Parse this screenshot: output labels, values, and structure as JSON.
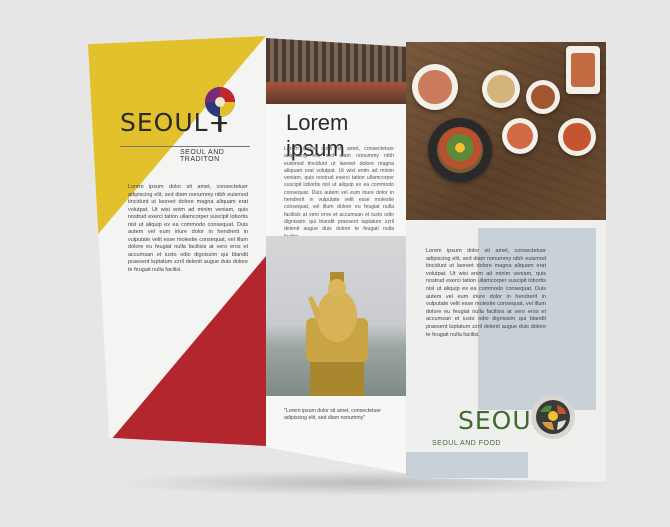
{
  "left_panel": {
    "brand": "SEOUL+",
    "tagline": "SEOUL AND TRADITON",
    "body": "Lorem ipsum dolor sit amet, consectetuer adipiscing elit, sed diam nonummy nibh euismod tincidunt ut laoreet dolore magna aliquam erat volutpat. Ut wisi enim ad minim veniam, quis nostrud exerci tation ullamcorper suscipit lobortis nisl ut aliquip ex ea commodo consequat. Duis autem vel eum iriure dolor in hendrerit in vulputate velit esse molestie consequat, vel illum dolore eu feugiat nulla facilisis at vero eros et accumsan et iusto odio dignissim qui blandit praesent luptatum zzril delenit augue duis dolore te feugait nulla facilisi."
  },
  "middle_panel": {
    "title": "Lorem ipsum",
    "body": "Lorem ipsum dolor sit amet, consectetuer adipiscing elit, sed diam nonummy nibh euismod tincidunt ut laoreet dolore magna aliquam erat volutpat. Ut wisi enim ad minim veniam, quis nostrud exerci tation ullamcorper suscipit lobortis nisl ut aliquip ex ea commodo consequat. Duis autem vel eum iriure dolor in hendrerit in vulputate velit esse molestie consequat, vel illum dolore eu feugiat nulla facilisis at vero eros et accumsan et iusto odio dignissim qui blandit praesent luptatum zzril delenit augue duis dolore te feugait nulla facilisi.",
    "caption": "\"Lorem ipsum dolor sit amet, consectetuer adipiscing elit, sed diam nonummy\""
  },
  "right_panel": {
    "body": "Lorem ipsum dolor sit amet, consectetuer adipiscing elit, sed diam nonummy nibh euismod tincidunt ut laoreet dolore magna aliquam erat volutpat. Ut wisi enim ad minim veniam, quis nostrud exerci tation ullamcorper suscipit lobortis nisl ut aliquip ex ea commodo consequat. Duis autem vel eum iriure dolor in hendrerit in vulputate velit esse molestie consequat, vel illum dolore eu feugiat nulla facilisis at vero eros et accumsan et iusto odio dignissim qui blandit praesent luptatum zzril delenit augue duis dolore te feugait nulla facilisi.",
    "brand": "SEOUL+",
    "tagline": "SEOUL AND FOOD"
  },
  "colors": {
    "background": "#e6e6e6",
    "yellow": "#e2c12d",
    "red": "#b3262d",
    "green": "#3e6b2d",
    "blue_block": "#b8c4cf"
  },
  "icons": [
    "fan-icon",
    "food-bowl-icon"
  ]
}
